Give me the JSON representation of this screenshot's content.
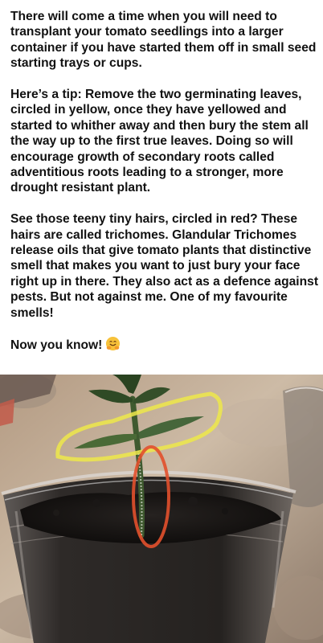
{
  "post": {
    "paragraphs": [
      "There will come a time when you will need to transplant your tomato seedlings into a larger container if you have started them off in small seed starting trays or cups.",
      "Here’s a tip: Remove the two germinating leaves, circled in yellow, once they have yellowed and started to whither away and then bury the stem all the way up to the first true leaves. Doing so will encourage growth of secondary roots called adventitious roots leading to a stronger, more drought resistant plant.",
      "See those teeny tiny hairs, circled in red? These hairs are called trichomes. Glandular Trichomes release oils that give tomato plants that distinctive smell that makes you want to just bury your face right up in there. They also act as a defence against pests. But not against me. One of my favourite smells!"
    ],
    "closing": "Now you know!",
    "emoji_icon": "hugging-face-emoji"
  },
  "photo": {
    "subject": "tomato-seedling-in-cup",
    "highlight_colors": {
      "cotyledons": "#ede84a",
      "trichomes": "#e2502c"
    }
  }
}
